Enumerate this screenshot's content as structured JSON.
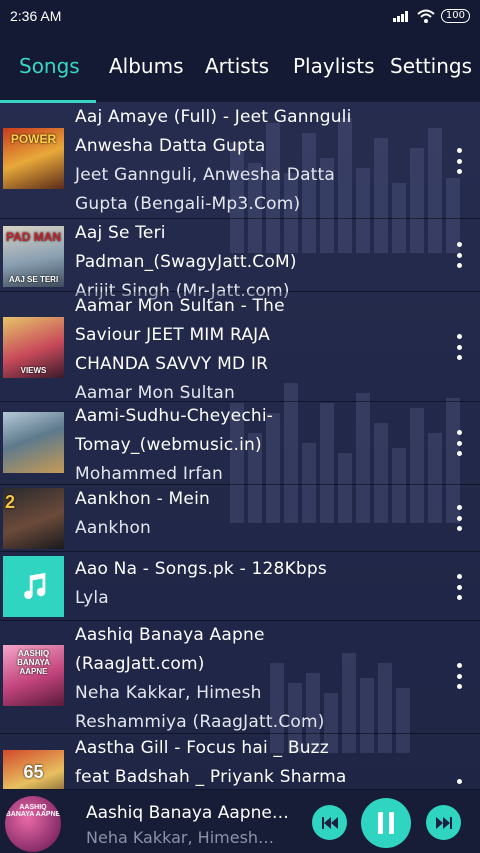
{
  "status_bar": {
    "time": "2:36 AM",
    "battery": "100"
  },
  "tabs": [
    {
      "label": "Songs",
      "active": true
    },
    {
      "label": "Albums",
      "active": false
    },
    {
      "label": "Artists",
      "active": false
    },
    {
      "label": "Playlists",
      "active": false
    },
    {
      "label": "Settings",
      "active": false
    }
  ],
  "songs": [
    {
      "lines": [
        "Aaj Amaye (Full) - Jeet Gannguli",
        "Anwesha Datta Gupta"
      ],
      "artist_lines": [
        "Jeet Gannguli, Anwesha Datta",
        "Gupta (Bengali-Mp3.Com)"
      ],
      "thumb_text": "POWER",
      "thumb_sub": ""
    },
    {
      "lines": [
        "Aaj Se Teri",
        "Padman_(SwagyJatt.CoM)"
      ],
      "artist_lines": [
        "Arijit Singh (Mr-Jatt.com)"
      ],
      "thumb_text": "PAD MAN",
      "thumb_sub": "AAJ SE TERI"
    },
    {
      "lines": [
        "Aamar Mon  Sultan - The",
        "Saviour  JEET  MIM  RAJA",
        "CHANDA  SAVVY  MD IR"
      ],
      "artist_lines": [
        "Aamar Mon  Sultan"
      ],
      "thumb_text": "",
      "thumb_sub": "VIEWS"
    },
    {
      "lines": [
        "Aami-Sudhu-Cheyechi-",
        "Tomay_(webmusic.in)"
      ],
      "artist_lines": [
        "Mohammed Irfan"
      ],
      "thumb_text": "",
      "thumb_sub": ""
    },
    {
      "lines": [
        "Aankhon - Mein"
      ],
      "artist_lines": [
        "Aankhon"
      ],
      "thumb_text": "2",
      "thumb_sub": ""
    },
    {
      "lines": [
        "Aao Na - Songs.pk - 128Kbps"
      ],
      "artist_lines": [
        "Lyla"
      ],
      "thumb_text": "",
      "thumb_sub": ""
    },
    {
      "lines": [
        "Aashiq Banaya Aapne",
        "(RaagJatt.com)"
      ],
      "artist_lines": [
        "Neha Kakkar, Himesh",
        "Reshammiya (RaagJatt.Com)"
      ],
      "thumb_text": "AASHIQ BANAYA AAPNE",
      "thumb_sub": ""
    },
    {
      "lines": [
        "Aastha Gill - Focus hai _ Buzz",
        "feat Badshah _  Priyank Sharma"
      ],
      "artist_lines": [],
      "thumb_text": "65",
      "thumb_sub": ""
    }
  ],
  "now_playing": {
    "title": "Aashiq Banaya Aapne…",
    "artist": "Neha Kakkar, Himesh…",
    "art_text": "AASHIQ BANAYA AAPNE"
  },
  "colors": {
    "accent": "#2fd5c0",
    "tab_active": "#39d6c4",
    "background": "#1d2340"
  }
}
